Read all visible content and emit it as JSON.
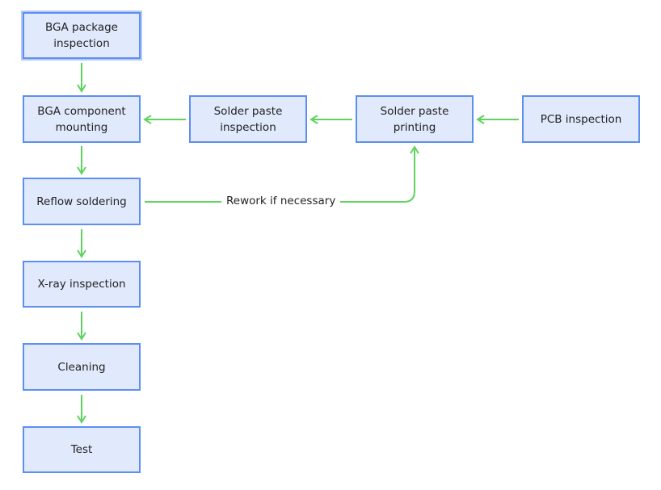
{
  "nodes": {
    "bga_package_inspection": "BGA package inspection",
    "bga_component_mounting": "BGA component mounting",
    "solder_paste_inspection": "Solder paste inspection",
    "solder_paste_printing": "Solder paste printing",
    "pcb_inspection": "PCB inspection",
    "reflow_soldering": "Reflow soldering",
    "xray_inspection": "X-ray inspection",
    "cleaning": "Cleaning",
    "test": "Test"
  },
  "edges": {
    "rework_label": "Rework if necessary"
  },
  "colors": {
    "box_fill": "#e1e9fc",
    "box_border": "#5d8ff0",
    "arrow": "#5fd35f"
  }
}
